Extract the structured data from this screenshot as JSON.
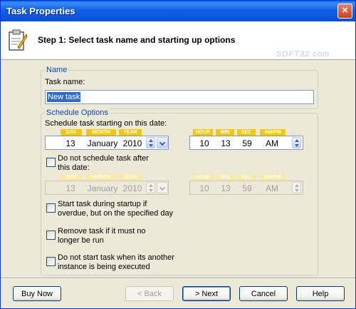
{
  "window": {
    "title": "Task Properties",
    "close_glyph": "×"
  },
  "header": {
    "step_text": "Step 1: Select task name and starting up options",
    "watermark": "SOFT32.com"
  },
  "name_group": {
    "legend": "Name",
    "task_name_label": "Task name:",
    "task_name_value": "New task"
  },
  "schedule_group": {
    "legend": "Schedule Options",
    "start_label": "Schedule task starting on this date:",
    "date_captions": [
      "DAY",
      "MONTH",
      "YEAR"
    ],
    "time_captions": [
      "HOUR",
      "MIN",
      "SEC",
      "AM/PM"
    ],
    "start_date": {
      "day": "13",
      "month": "January",
      "year": "2010"
    },
    "start_time": {
      "hour": "10",
      "min": "13",
      "sec": "59",
      "ampm": "AM"
    },
    "no_end_label": "Do not schedule task after this date:",
    "end_date": {
      "day": "13",
      "month": "January",
      "year": "2010"
    },
    "end_time": {
      "hour": "10",
      "min": "13",
      "sec": "59",
      "ampm": "AM"
    },
    "checkboxes": [
      {
        "label": "Start task during startup if overdue, but on the specified day",
        "checked": false
      },
      {
        "label": "Remove task if it must no longer be run",
        "checked": false
      },
      {
        "label": "Do not start task when its another instance is being executed",
        "checked": false
      }
    ],
    "no_end_checked": false
  },
  "buttons": {
    "buy_now": "Buy Now",
    "back": "< Back",
    "next": "> Next",
    "cancel": "Cancel",
    "help": "Help"
  },
  "colors": {
    "title_bar": "#0a4fd8",
    "legend": "#0046d5",
    "caption_bg": "#f7c700",
    "selection": "#316ac5"
  }
}
